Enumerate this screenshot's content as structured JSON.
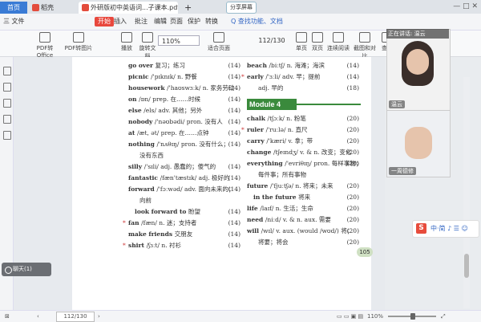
{
  "tabs": {
    "home": "首页",
    "app": "稻壳",
    "doc": "外研版初中英语词...子课本.pdf",
    "add": "+"
  },
  "share_label": "分享屏幕",
  "window_controls": "— □ ✕",
  "menu": [
    "三 文件",
    "开始",
    "插入",
    "批注",
    "编辑",
    "页面",
    "保护",
    "转换"
  ],
  "menu_search": "Q 查找功能、文档",
  "toolbar": {
    "tools": [
      "PDF转Office",
      "PDF转图片",
      "播放",
      "旋转文档",
      "适合页面",
      "单页",
      "双页",
      "连续阅读",
      "截图和对比",
      "查找"
    ],
    "zoom": "110%",
    "page": "112/130"
  },
  "dictionary": {
    "left_entries": [
      {
        "word": "go over",
        "def": "复习；练习",
        "page": "(14)"
      },
      {
        "word": "picnic",
        "def": "/'pɪknɪk/ n. 野餐",
        "page": "(14)"
      },
      {
        "word": "housework",
        "def": "/'haʊswɜːk/ n. 家务劳动",
        "page": "(14)"
      },
      {
        "word": "on",
        "def": "/ɒn/ prep. 在……时候",
        "page": "(14)"
      },
      {
        "word": "else",
        "def": "/els/ adv. 其他；另外",
        "page": "(14)"
      },
      {
        "word": "nobody",
        "def": "/'nəʊbədi/ pron. 没有人",
        "page": "(14)"
      },
      {
        "word": "at",
        "def": "/æt, ət/ prep. 在……点钟",
        "page": "(14)"
      },
      {
        "word": "nothing",
        "def": "/'nʌθɪŋ/ pron. 没有什么；",
        "page": "(14)"
      },
      {
        "word": "",
        "def": "没有东西",
        "page": "",
        "cont": true
      },
      {
        "word": "silly",
        "def": "/'sɪli/ adj. 愚蠢的；傻气的",
        "page": "(14)"
      },
      {
        "word": "fantastic",
        "def": "/fæn'tæstɪk/ adj. 极好的",
        "page": "(14)"
      },
      {
        "word": "forward",
        "def": "/'fɔːwəd/ adv. 面向未来的；",
        "page": "(14)"
      },
      {
        "word": "",
        "def": "向前",
        "page": "",
        "cont": true
      },
      {
        "word": "look forward to",
        "def": "盼望",
        "page": "(14)",
        "indent": true
      },
      {
        "word": "fan",
        "def": "/fæn/ n. 迷；支持者",
        "page": "(14)",
        "star": true
      },
      {
        "word": "make friends",
        "def": "交朋友",
        "page": "(14)"
      },
      {
        "word": "shirt",
        "def": "/ʃɜːt/ n. 衬衫",
        "page": "(14)",
        "star": true
      }
    ],
    "right_top_entries": [
      {
        "word": "beach",
        "def": "/biːtʃ/ n. 海滩；海滨",
        "page": "(14)"
      },
      {
        "word": "early",
        "def": "/'ɜːli/ adv. 早；提前",
        "page": "(14)",
        "star": true
      },
      {
        "word": "",
        "def": "adj. 早的",
        "page": "(18)",
        "cont": true
      }
    ],
    "module_title": "Module 4",
    "right_entries": [
      {
        "word": "chalk",
        "def": "/tʃɔːk/ n. 粉笔",
        "page": "(20)"
      },
      {
        "word": "ruler",
        "def": "/'ruːlə/ n. 直尺",
        "page": "(20)",
        "star": true
      },
      {
        "word": "carry",
        "def": "/'kæri/ v. 拿；带",
        "page": "(20)"
      },
      {
        "word": "change",
        "def": "/tʃeɪndʒ/ v. & n. 改变；变化",
        "page": "(20)"
      },
      {
        "word": "everything",
        "def": "/'evriθɪŋ/ pron. 每样事物；",
        "page": "(20)"
      },
      {
        "word": "",
        "def": "每件事；所有事物",
        "page": "",
        "cont": true
      },
      {
        "word": "future",
        "def": "/'fjuːtʃə/ n. 将来；未来",
        "page": "(20)"
      },
      {
        "word": "in the future",
        "def": "将来",
        "page": "(20)",
        "indent": true
      },
      {
        "word": "life",
        "def": "/laɪf/ n. 生活；生命",
        "page": "(20)"
      },
      {
        "word": "need",
        "def": "/niːd/ v. & n. aux. 需要",
        "page": "(20)"
      },
      {
        "word": "will",
        "def": "/wɪl/ v. aux. (would /wʊd/) 将；",
        "page": "(20)"
      },
      {
        "word": "",
        "def": "将要；将会",
        "page": "(20)",
        "cont": true
      }
    ],
    "page_number": "105"
  },
  "video": {
    "title": "正在讲话: 温云",
    "teacher": "温云",
    "student": "一周德修"
  },
  "sogou": {
    "logo": "S",
    "text": "中·简 ♪ ☰ ☺"
  },
  "chat_label": "聊天(1)",
  "status": {
    "page": "112/130",
    "zoom": "110%"
  }
}
